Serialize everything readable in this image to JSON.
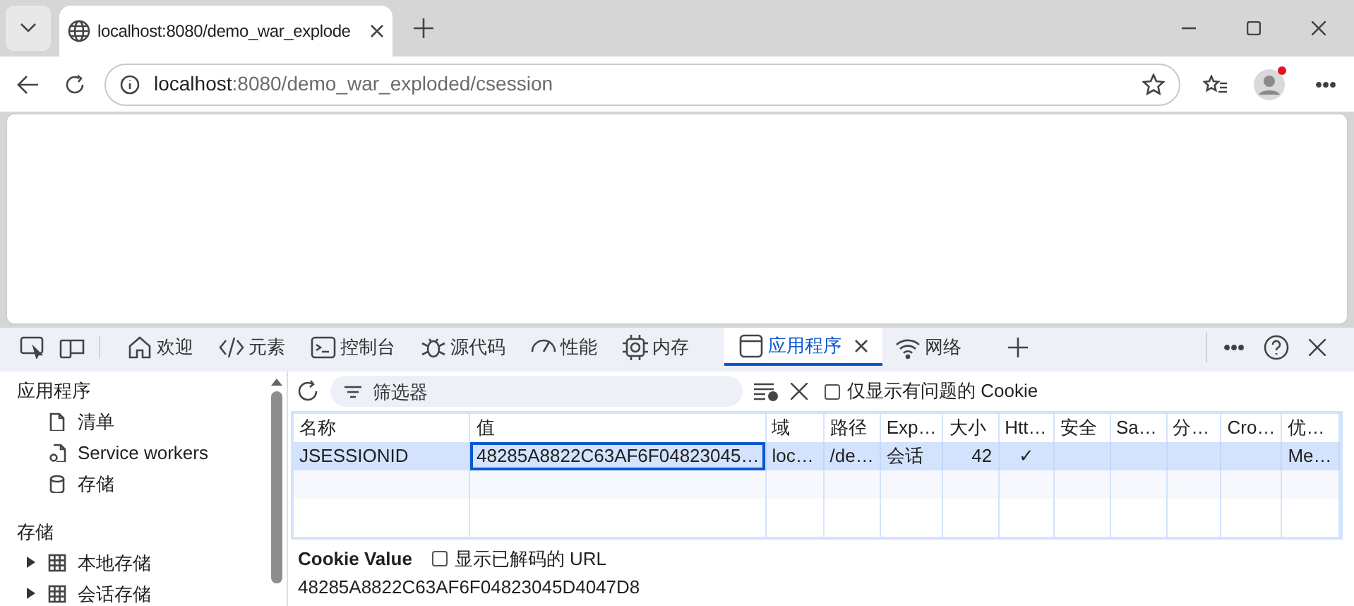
{
  "browser_tab": {
    "title": "localhost:8080/demo_war_explode"
  },
  "address_bar": {
    "host": "localhost",
    "rest": ":8080/demo_war_exploded/csession"
  },
  "devtools_tabs": [
    {
      "label": "欢迎",
      "selected": false
    },
    {
      "label": "元素",
      "selected": false
    },
    {
      "label": "控制台",
      "selected": false
    },
    {
      "label": "源代码",
      "selected": false
    },
    {
      "label": "性能",
      "selected": false
    },
    {
      "label": "内存",
      "selected": false
    },
    {
      "label": "应用程序",
      "selected": true
    },
    {
      "label": "网络",
      "selected": false
    }
  ],
  "sidebar": {
    "sections": [
      {
        "title": "应用程序",
        "items": [
          {
            "label": "清单"
          },
          {
            "label": "Service workers"
          },
          {
            "label": "存储"
          }
        ]
      },
      {
        "title": "存储",
        "items": [
          {
            "label": "本地存储",
            "expanded": false
          },
          {
            "label": "会话存储",
            "expanded": false
          }
        ]
      }
    ]
  },
  "toolbar": {
    "filter_placeholder": "筛选器",
    "only_issues": {
      "label": "仅显示有问题的 Cookie",
      "checked": false
    }
  },
  "table": {
    "columns": [
      "名称",
      "值",
      "域",
      "路径",
      "Exp…",
      "大小",
      "Htt…",
      "安全",
      "Sa…",
      "分…",
      "Cro…",
      "优…"
    ],
    "rows": [
      {
        "selected": true,
        "cells": [
          "JSESSIONID",
          "48285A8822C63AF6F04823045…",
          "loc…",
          "/de…",
          "会话",
          "42",
          "✓",
          "",
          "",
          "",
          "",
          "Me…"
        ]
      }
    ]
  },
  "cookie_value": {
    "title": "Cookie Value",
    "show_decoded": {
      "label": "显示已解码的 URL",
      "checked": false
    },
    "value": "48285A8822C63AF6F04823045D4047D8"
  }
}
